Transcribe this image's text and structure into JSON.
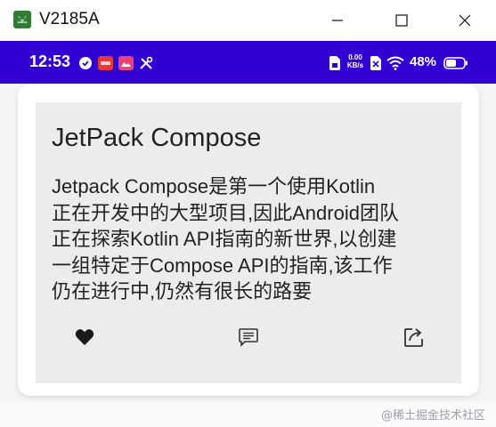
{
  "window": {
    "title": "V2185A",
    "app_icon": "android-icon",
    "controls": [
      "minimize",
      "maximize",
      "close"
    ]
  },
  "status_bar": {
    "time": "12:53",
    "left_icons": [
      "shield-check-icon",
      "red-app-icon",
      "pink-app-icon",
      "tools-icon"
    ],
    "right_icons": [
      "sim-icon",
      "network-speed-icon",
      "no-sim-icon",
      "wifi-icon"
    ],
    "net_speed_top": "0.00",
    "net_speed_bottom": "KB/s",
    "battery": "48%",
    "background_color": "#3200d2"
  },
  "card": {
    "title": "JetPack Compose",
    "body": " Jetpack Compose是第一个使用Kotlin\n正在开发中的大型项目,因此Android团队\n正在探索Kotlin API指南的新世界,以创建\n一组特定于Compose API的指南,该工作\n仍在进行中,仍然有很长的路要",
    "actions": [
      {
        "name": "favorite",
        "icon": "heart-icon"
      },
      {
        "name": "comment",
        "icon": "comment-icon"
      },
      {
        "name": "share",
        "icon": "share-icon"
      }
    ]
  },
  "watermark": "@稀土掘金技术社区"
}
